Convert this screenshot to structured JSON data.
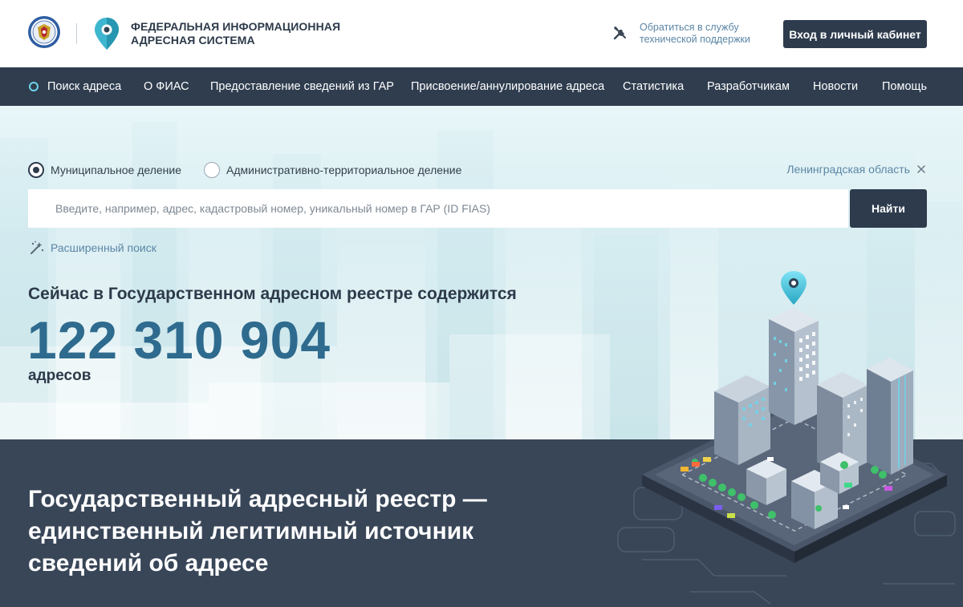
{
  "header": {
    "brand_line1": "ФЕДЕРАЛЬНАЯ ИНФОРМАЦИОННАЯ",
    "brand_line2": "АДРЕСНАЯ СИСТЕМА",
    "support_line1": "Обратиться в службу",
    "support_line2": "технической поддержки",
    "login_label": "Вход в личный кабинет"
  },
  "nav": {
    "items": [
      {
        "label": "Поиск адреса",
        "active": true
      },
      {
        "label": "О ФИАС"
      },
      {
        "label": "Предоставление сведений из ГАР"
      },
      {
        "label": "Присвоение/аннулирование адреса"
      },
      {
        "label": "Статистика"
      },
      {
        "label": "Разработчикам"
      },
      {
        "label": "Новости"
      },
      {
        "label": "Помощь"
      }
    ]
  },
  "search": {
    "radio_municipal": "Муниципальное деление",
    "radio_admin": "Административно-территориальное деление",
    "selected": "municipal",
    "region": "Ленинградская область",
    "placeholder": "Введите, например, адрес, кадастровый номер, уникальный номер в ГАР (ID FIAS)",
    "value": "",
    "submit_label": "Найти",
    "advanced_label": "Расширенный поиск"
  },
  "stats": {
    "heading": "Сейчас в Государственном адресном реестре содержится",
    "count": "122 310 904",
    "unit": "адресов"
  },
  "tagline": {
    "line1": "Государственный адресный реестр —",
    "line2": "единственный легитимный источник",
    "line3": "сведений об адресе"
  },
  "colors": {
    "dark_navy": "#2d3b4d",
    "nav_bg": "#2f3d4f",
    "accent_blue": "#5b86a6",
    "number_blue": "#2e6b8e",
    "dark_section": "#384658",
    "pin_teal": "#6fd5ea"
  },
  "icons": {
    "emblem": "fns-emblem-icon",
    "logo": "map-pin-logo-icon",
    "support": "tools-icon",
    "region_clear": "close-icon",
    "advanced": "magic-wand-icon"
  }
}
